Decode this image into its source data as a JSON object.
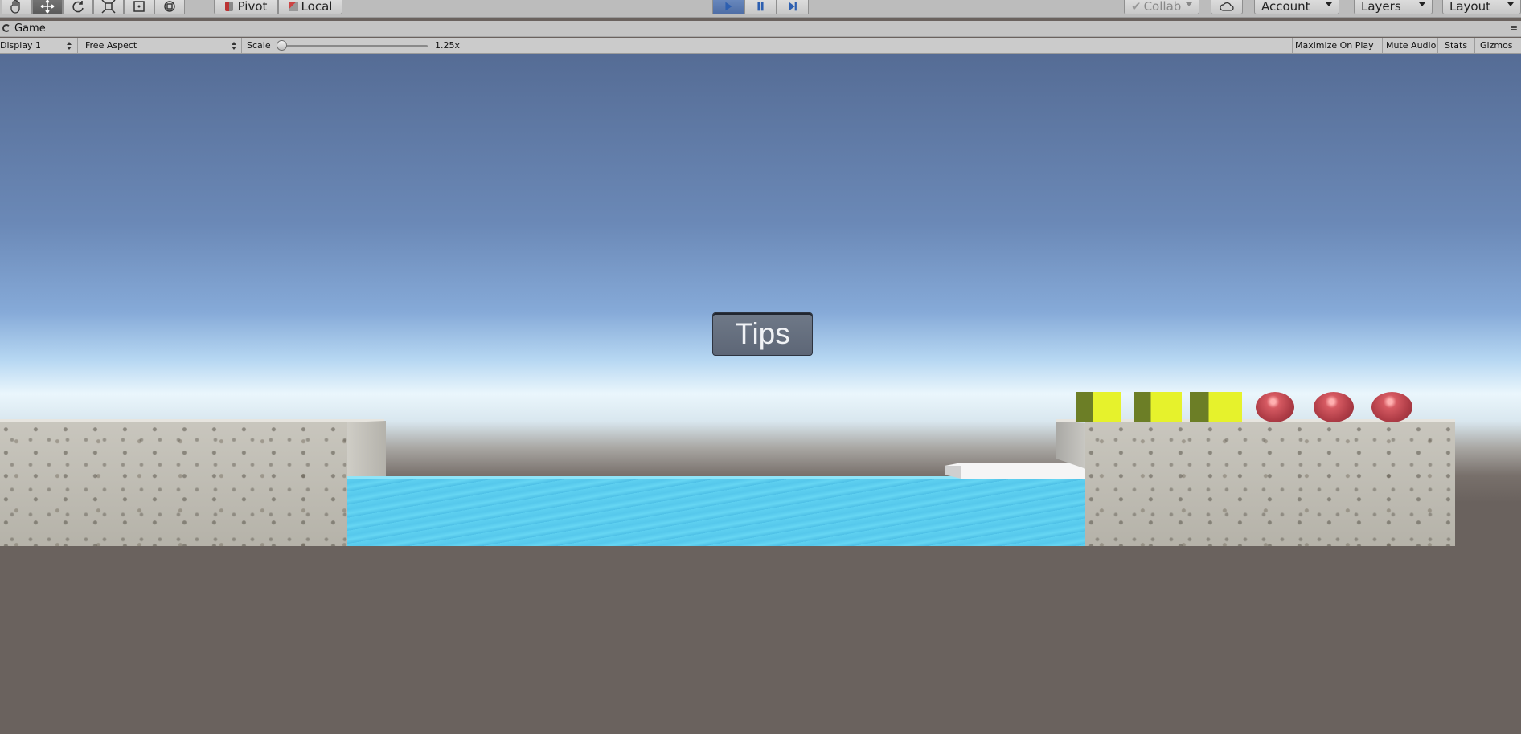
{
  "toolbar": {
    "pivot_label": "Pivot",
    "local_label": "Local",
    "collab_label": "Collab",
    "account_label": "Account",
    "layers_label": "Layers",
    "layout_label": "Layout"
  },
  "tab": {
    "title": "Game"
  },
  "game_controls": {
    "display": "Display 1",
    "aspect": "Free Aspect",
    "scale_label": "Scale",
    "scale_value": "1.25x",
    "maximize_on_play": "Maximize On Play",
    "mute_audio": "Mute Audio",
    "stats": "Stats",
    "gizmos": "Gizmos"
  },
  "game": {
    "tips_button": "Tips",
    "colors": {
      "sky_top": "#556c95",
      "ground": "#6a625e",
      "water": "#5ed0f0",
      "cube_face": "#e6f22c",
      "ball": "#b03d47"
    }
  },
  "icons": [
    "hand-icon",
    "move-icon",
    "rotate-icon",
    "scale-icon",
    "rect-icon",
    "transform-icon",
    "pivot-icon",
    "local-icon",
    "play-icon",
    "pause-icon",
    "step-icon",
    "check-icon",
    "cloud-icon",
    "game-tab-icon"
  ]
}
